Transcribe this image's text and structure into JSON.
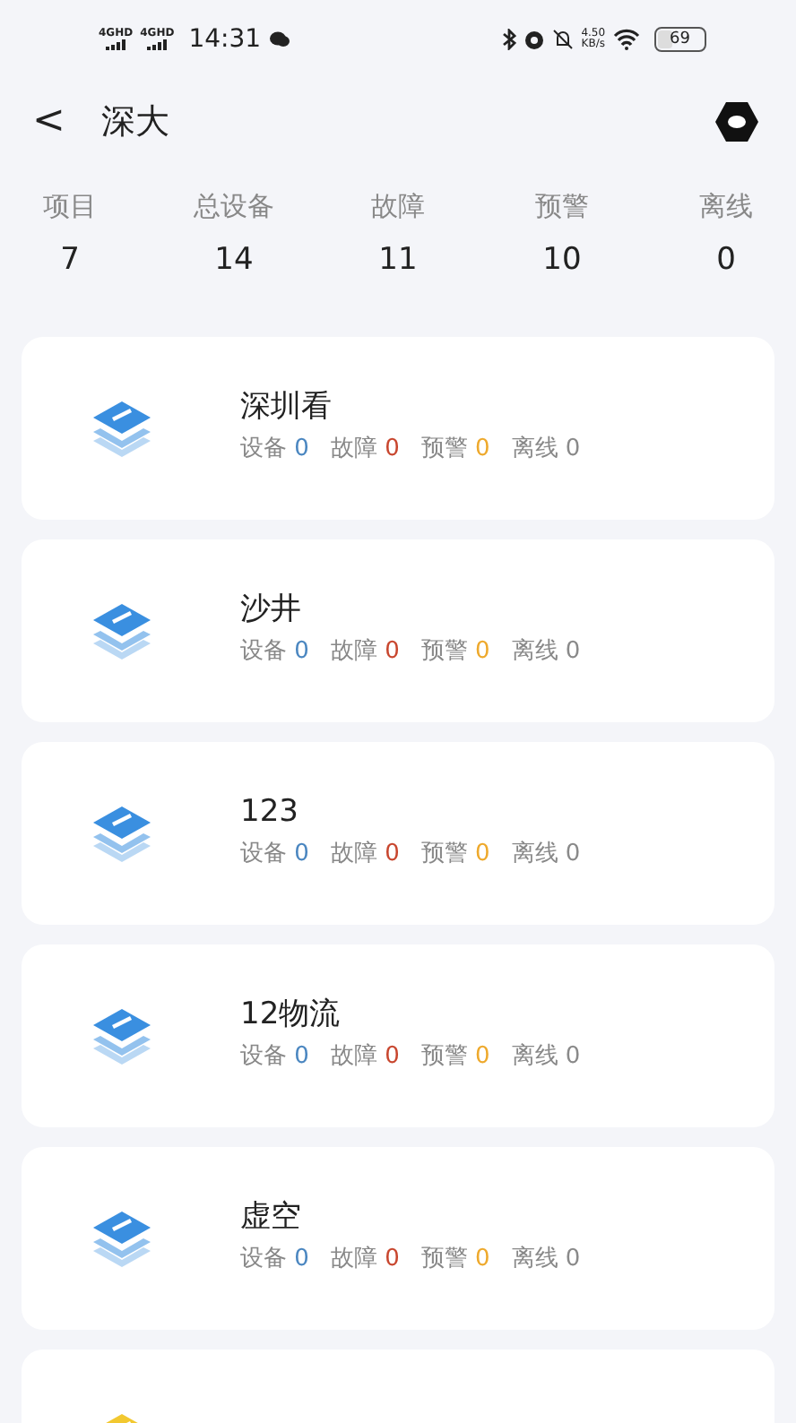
{
  "status_bar": {
    "signals": [
      "4GHD",
      "4GHD"
    ],
    "time": "14:31",
    "net_speed": "4.50",
    "net_unit": "KB/s",
    "battery": "69"
  },
  "header": {
    "back": "<",
    "title": "深大"
  },
  "summary": [
    {
      "label": "项目",
      "value": "7"
    },
    {
      "label": "总设备",
      "value": "14"
    },
    {
      "label": "故障",
      "value": "11"
    },
    {
      "label": "预警",
      "value": "10"
    },
    {
      "label": "离线",
      "value": "0"
    }
  ],
  "projects": [
    {
      "name": "深圳看",
      "color": "#3a8fe0",
      "stats": [
        {
          "label": "设备",
          "value": "0",
          "color": "#4a86c0"
        },
        {
          "label": "故障",
          "value": "0",
          "color": "#c8462e"
        },
        {
          "label": "预警",
          "value": "0",
          "color": "#eea92c"
        },
        {
          "label": "离线",
          "value": "0",
          "color": "#8a8a8a"
        }
      ]
    },
    {
      "name": "沙井",
      "color": "#3a8fe0",
      "stats": [
        {
          "label": "设备",
          "value": "0",
          "color": "#4a86c0"
        },
        {
          "label": "故障",
          "value": "0",
          "color": "#c8462e"
        },
        {
          "label": "预警",
          "value": "0",
          "color": "#eea92c"
        },
        {
          "label": "离线",
          "value": "0",
          "color": "#8a8a8a"
        }
      ]
    },
    {
      "name": "123",
      "color": "#3a8fe0",
      "stats": [
        {
          "label": "设备",
          "value": "0",
          "color": "#4a86c0"
        },
        {
          "label": "故障",
          "value": "0",
          "color": "#c8462e"
        },
        {
          "label": "预警",
          "value": "0",
          "color": "#eea92c"
        },
        {
          "label": "离线",
          "value": "0",
          "color": "#8a8a8a"
        }
      ]
    },
    {
      "name": "12物流",
      "color": "#3a8fe0",
      "stats": [
        {
          "label": "设备",
          "value": "0",
          "color": "#4a86c0"
        },
        {
          "label": "故障",
          "value": "0",
          "color": "#c8462e"
        },
        {
          "label": "预警",
          "value": "0",
          "color": "#eea92c"
        },
        {
          "label": "离线",
          "value": "0",
          "color": "#8a8a8a"
        }
      ]
    },
    {
      "name": "虚空",
      "color": "#3a8fe0",
      "stats": [
        {
          "label": "设备",
          "value": "0",
          "color": "#4a86c0"
        },
        {
          "label": "故障",
          "value": "0",
          "color": "#c8462e"
        },
        {
          "label": "预警",
          "value": "0",
          "color": "#eea92c"
        },
        {
          "label": "离线",
          "value": "0",
          "color": "#8a8a8a"
        }
      ]
    },
    {
      "color": "#f2c830"
    }
  ]
}
